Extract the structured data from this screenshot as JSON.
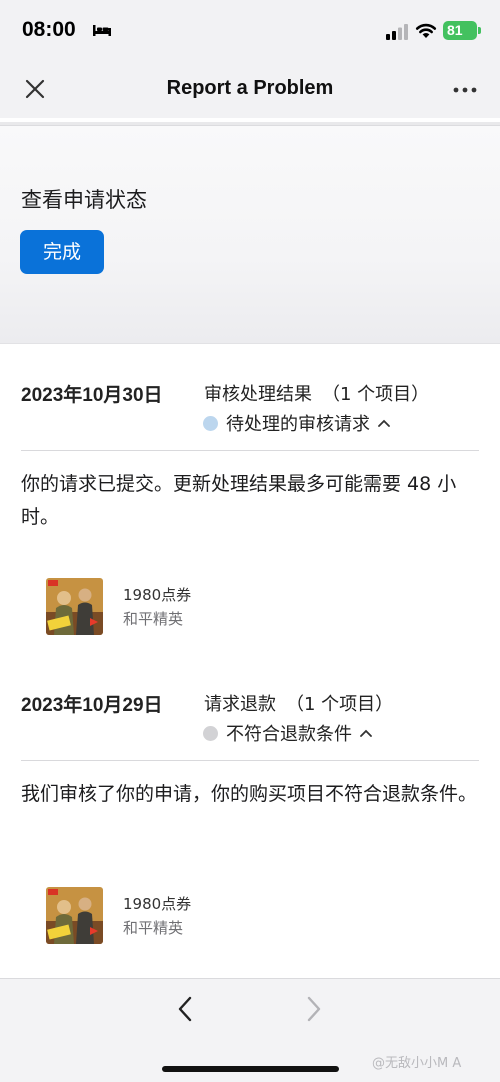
{
  "status_bar": {
    "time": "08:00",
    "battery": "81",
    "icons": [
      "bed-icon",
      "cellular-icon",
      "wifi-icon",
      "battery-icon"
    ]
  },
  "nav": {
    "title": "Report a Problem",
    "close_icon": "close-icon",
    "more_icon": "more-icon"
  },
  "header": {
    "heading": "查看申请状态",
    "done_label": "完成",
    "done_color": "#0a72d9"
  },
  "requests": [
    {
      "date": "2023年10月30日",
      "type": "审核处理结果",
      "count": "（1 个项目）",
      "status": "待处理的审核请求",
      "status_dot_color": "#bcd6ee",
      "message": "你的请求已提交。更新处理结果最多可能需要 48 小时。",
      "product": {
        "name": "1980点券",
        "game": "和平精英"
      }
    },
    {
      "date": "2023年10月29日",
      "type": "请求退款",
      "count": "（1 个项目）",
      "status": "不符合退款条件",
      "status_dot_color": "#d2d2d5",
      "message": "我们审核了你的申请，你的购买项目不符合退款条件。",
      "product": {
        "name": "1980点券",
        "game": "和平精英"
      }
    }
  ],
  "toolbar": {
    "back_icon": "chevron-left-icon",
    "forward_icon": "chevron-right-icon"
  },
  "watermark": "@无敌小小M A"
}
